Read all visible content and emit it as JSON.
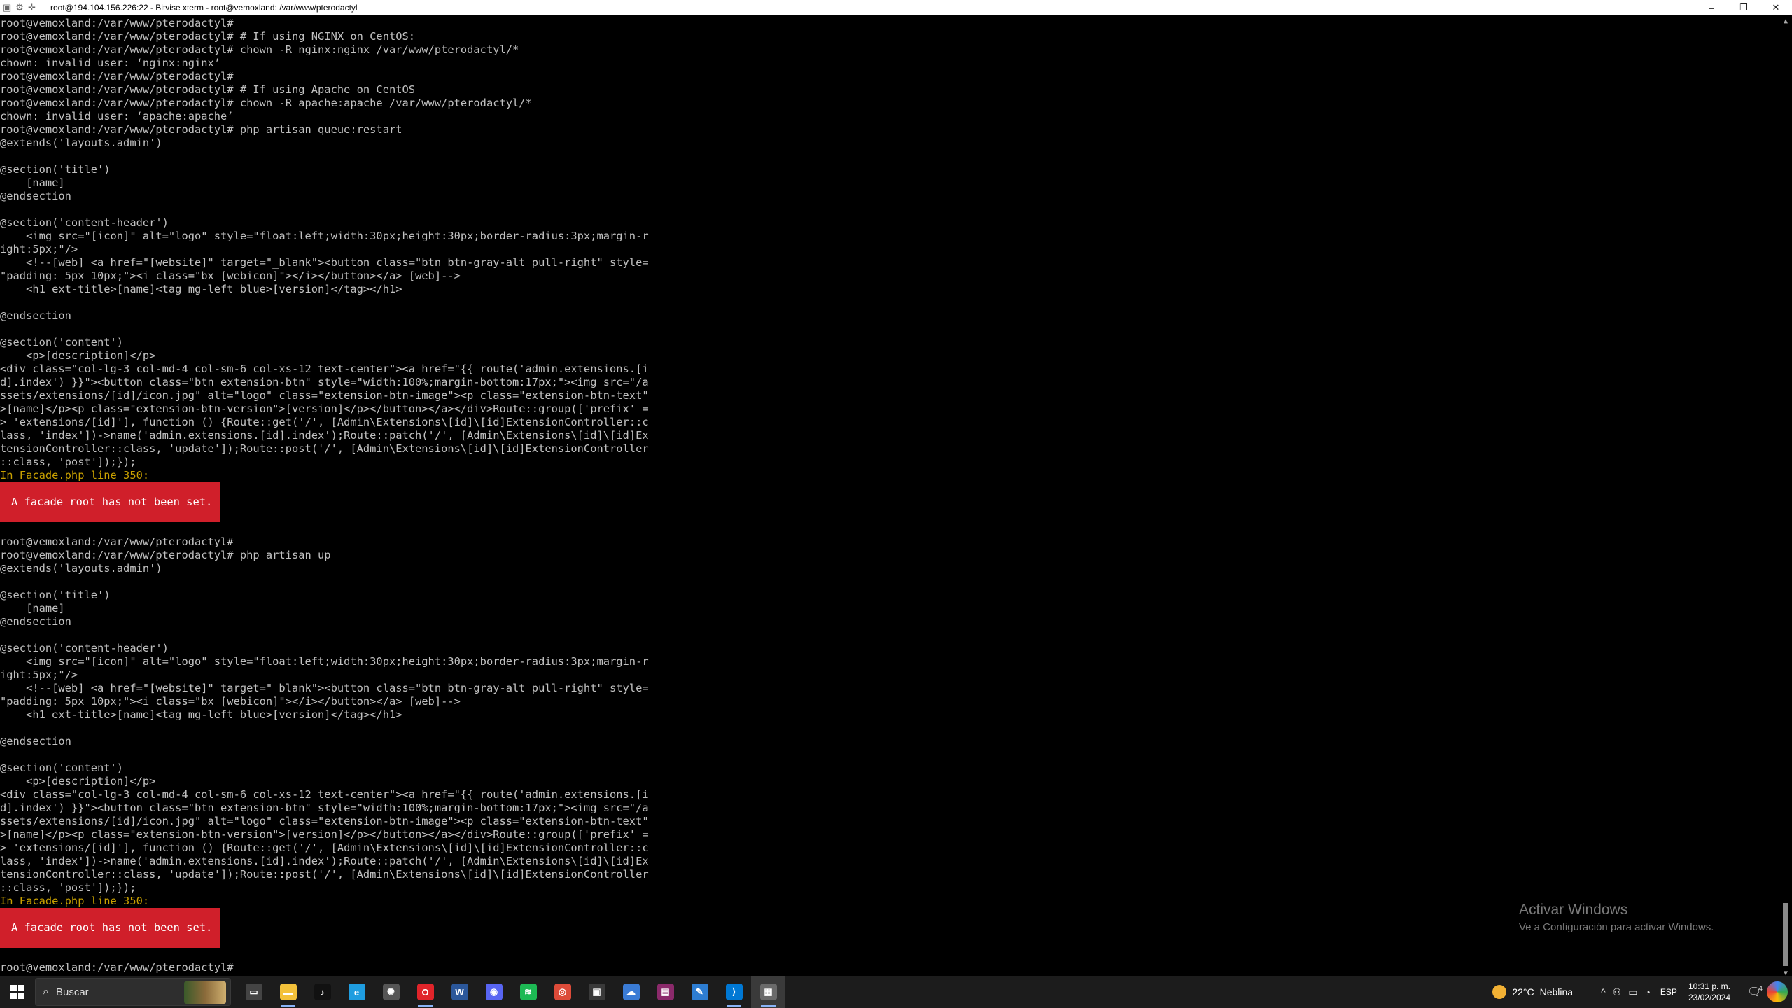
{
  "window": {
    "title": "root@194.104.156.226:22 - Bitvise xterm - root@vemoxland: /var/www/pterodactyl",
    "controls": [
      "–",
      "❐",
      "✕"
    ]
  },
  "terminal": {
    "lines": [
      {
        "text": "root@vemoxland:/var/www/pterodactyl#",
        "type": "normal"
      },
      {
        "text": "root@vemoxland:/var/www/pterodactyl# # If using NGINX on CentOS:",
        "type": "normal"
      },
      {
        "text": "root@vemoxland:/var/www/pterodactyl# chown -R nginx:nginx /var/www/pterodactyl/*",
        "type": "normal"
      },
      {
        "text": "chown: invalid user: ‘nginx:nginx’",
        "type": "normal"
      },
      {
        "text": "root@vemoxland:/var/www/pterodactyl#",
        "type": "normal"
      },
      {
        "text": "root@vemoxland:/var/www/pterodactyl# # If using Apache on CentOS",
        "type": "normal"
      },
      {
        "text": "root@vemoxland:/var/www/pterodactyl# chown -R apache:apache /var/www/pterodactyl/*",
        "type": "normal"
      },
      {
        "text": "chown: invalid user: ‘apache:apache’",
        "type": "normal"
      },
      {
        "text": "root@vemoxland:/var/www/pterodactyl# php artisan queue:restart",
        "type": "normal"
      },
      {
        "text": "@extends('layouts.admin')",
        "type": "normal"
      },
      {
        "text": "",
        "type": "normal"
      },
      {
        "text": "@section('title')",
        "type": "normal"
      },
      {
        "text": "    [name]",
        "type": "normal"
      },
      {
        "text": "@endsection",
        "type": "normal"
      },
      {
        "text": "",
        "type": "normal"
      },
      {
        "text": "@section('content-header')",
        "type": "normal"
      },
      {
        "text": "    <img src=\"[icon]\" alt=\"logo\" style=\"float:left;width:30px;height:30px;border-radius:3px;margin-r",
        "type": "normal"
      },
      {
        "text": "ight:5px;\"/>",
        "type": "normal"
      },
      {
        "text": "    <!--[web] <a href=\"[website]\" target=\"_blank\"><button class=\"btn btn-gray-alt pull-right\" style=",
        "type": "normal"
      },
      {
        "text": "\"padding: 5px 10px;\"><i class=\"bx [webicon]\"></i></button></a> [web]-->",
        "type": "normal"
      },
      {
        "text": "    <h1 ext-title>[name]<tag mg-left blue>[version]</tag></h1>",
        "type": "normal"
      },
      {
        "text": "",
        "type": "normal"
      },
      {
        "text": "@endsection",
        "type": "normal"
      },
      {
        "text": "",
        "type": "normal"
      },
      {
        "text": "@section('content')",
        "type": "normal"
      },
      {
        "text": "    <p>[description]</p>",
        "type": "normal"
      },
      {
        "text": "<div class=\"col-lg-3 col-md-4 col-sm-6 col-xs-12 text-center\"><a href=\"{{ route('admin.extensions.[i",
        "type": "normal"
      },
      {
        "text": "d].index') }}\"><button class=\"btn extension-btn\" style=\"width:100%;margin-bottom:17px;\"><img src=\"/a",
        "type": "normal"
      },
      {
        "text": "ssets/extensions/[id]/icon.jpg\" alt=\"logo\" class=\"extension-btn-image\"><p class=\"extension-btn-text\"",
        "type": "normal"
      },
      {
        "text": ">[name]</p><p class=\"extension-btn-version\">[version]</p></button></a></div>Route::group(['prefix' =",
        "type": "normal"
      },
      {
        "text": "> 'extensions/[id]'], function () {Route::get('/', [Admin\\Extensions\\[id]\\[id]ExtensionController::c",
        "type": "normal"
      },
      {
        "text": "lass, 'index'])->name('admin.extensions.[id].index');Route::patch('/', [Admin\\Extensions\\[id]\\[id]Ex",
        "type": "normal"
      },
      {
        "text": "tensionController::class, 'update']);Route::post('/', [Admin\\Extensions\\[id]\\[id]ExtensionController",
        "type": "normal"
      },
      {
        "text": "::class, 'post']);});",
        "type": "normal"
      },
      {
        "text": "In Facade.php line 350:",
        "type": "warn"
      },
      {
        "text": "A facade root has not been set.",
        "type": "error"
      },
      {
        "text": "",
        "type": "normal"
      },
      {
        "text": "root@vemoxland:/var/www/pterodactyl#",
        "type": "normal"
      },
      {
        "text": "root@vemoxland:/var/www/pterodactyl# php artisan up",
        "type": "normal"
      },
      {
        "text": "@extends('layouts.admin')",
        "type": "normal"
      },
      {
        "text": "",
        "type": "normal"
      },
      {
        "text": "@section('title')",
        "type": "normal"
      },
      {
        "text": "    [name]",
        "type": "normal"
      },
      {
        "text": "@endsection",
        "type": "normal"
      },
      {
        "text": "",
        "type": "normal"
      },
      {
        "text": "@section('content-header')",
        "type": "normal"
      },
      {
        "text": "    <img src=\"[icon]\" alt=\"logo\" style=\"float:left;width:30px;height:30px;border-radius:3px;margin-r",
        "type": "normal"
      },
      {
        "text": "ight:5px;\"/>",
        "type": "normal"
      },
      {
        "text": "    <!--[web] <a href=\"[website]\" target=\"_blank\"><button class=\"btn btn-gray-alt pull-right\" style=",
        "type": "normal"
      },
      {
        "text": "\"padding: 5px 10px;\"><i class=\"bx [webicon]\"></i></button></a> [web]-->",
        "type": "normal"
      },
      {
        "text": "    <h1 ext-title>[name]<tag mg-left blue>[version]</tag></h1>",
        "type": "normal"
      },
      {
        "text": "",
        "type": "normal"
      },
      {
        "text": "@endsection",
        "type": "normal"
      },
      {
        "text": "",
        "type": "normal"
      },
      {
        "text": "@section('content')",
        "type": "normal"
      },
      {
        "text": "    <p>[description]</p>",
        "type": "normal"
      },
      {
        "text": "<div class=\"col-lg-3 col-md-4 col-sm-6 col-xs-12 text-center\"><a href=\"{{ route('admin.extensions.[i",
        "type": "normal"
      },
      {
        "text": "d].index') }}\"><button class=\"btn extension-btn\" style=\"width:100%;margin-bottom:17px;\"><img src=\"/a",
        "type": "normal"
      },
      {
        "text": "ssets/extensions/[id]/icon.jpg\" alt=\"logo\" class=\"extension-btn-image\"><p class=\"extension-btn-text\"",
        "type": "normal"
      },
      {
        "text": ">[name]</p><p class=\"extension-btn-version\">[version]</p></button></a></div>Route::group(['prefix' =",
        "type": "normal"
      },
      {
        "text": "> 'extensions/[id]'], function () {Route::get('/', [Admin\\Extensions\\[id]\\[id]ExtensionController::c",
        "type": "normal"
      },
      {
        "text": "lass, 'index'])->name('admin.extensions.[id].index');Route::patch('/', [Admin\\Extensions\\[id]\\[id]Ex",
        "type": "normal"
      },
      {
        "text": "tensionController::class, 'update']);Route::post('/', [Admin\\Extensions\\[id]\\[id]ExtensionController",
        "type": "normal"
      },
      {
        "text": "::class, 'post']);});",
        "type": "normal"
      },
      {
        "text": "In Facade.php line 350:",
        "type": "warn"
      },
      {
        "text": "A facade root has not been set.",
        "type": "error"
      },
      {
        "text": "",
        "type": "normal"
      },
      {
        "text": "root@vemoxland:/var/www/pterodactyl#",
        "type": "normal"
      }
    ],
    "colors": {
      "text": "#c0c0c0",
      "warn": "#c8a000",
      "error_bg": "#d01f2a",
      "background": "#000000"
    }
  },
  "watermark": {
    "line1": "Activar Windows",
    "line2": "Ve a Configuración para activar Windows."
  },
  "taskbar": {
    "search_placeholder": "Buscar",
    "apps": [
      {
        "name": "task-view",
        "glyph": "▭",
        "color": "#444444"
      },
      {
        "name": "file-explorer",
        "glyph": "▬",
        "color": "#f3c13a"
      },
      {
        "name": "tiktok",
        "glyph": "♪",
        "color": "#111111"
      },
      {
        "name": "edge",
        "glyph": "e",
        "color": "#1f9de0"
      },
      {
        "name": "chatgpt",
        "glyph": "✺",
        "color": "#555555"
      },
      {
        "name": "opera",
        "glyph": "O",
        "color": "#e0242a"
      },
      {
        "name": "word",
        "glyph": "W",
        "color": "#2b579a"
      },
      {
        "name": "discord",
        "glyph": "◉",
        "color": "#5865f2"
      },
      {
        "name": "spotify",
        "glyph": "≋",
        "color": "#1db954"
      },
      {
        "name": "chrome",
        "glyph": "◎",
        "color": "#dd4b39"
      },
      {
        "name": "terminal-app",
        "glyph": "▣",
        "color": "#3a3a3a"
      },
      {
        "name": "cloud-app",
        "glyph": "☁",
        "color": "#3a7bd5"
      },
      {
        "name": "winrar",
        "glyph": "▤",
        "color": "#8b2a6b"
      },
      {
        "name": "visual-studio",
        "glyph": "✎",
        "color": "#2d7dd2"
      },
      {
        "name": "vscode",
        "glyph": "⟩",
        "color": "#0078d4"
      },
      {
        "name": "bitvise-xterm",
        "glyph": "▦",
        "color": "#6a6a6a"
      }
    ],
    "weather_temp": "22°C",
    "weather_desc": "Neblina",
    "tray_icons": [
      "^",
      "⚇",
      "▭",
      "◔"
    ],
    "language": "ESP",
    "time": "10:31 p. m.",
    "date": "23/02/2024",
    "notification_badge": "4"
  }
}
